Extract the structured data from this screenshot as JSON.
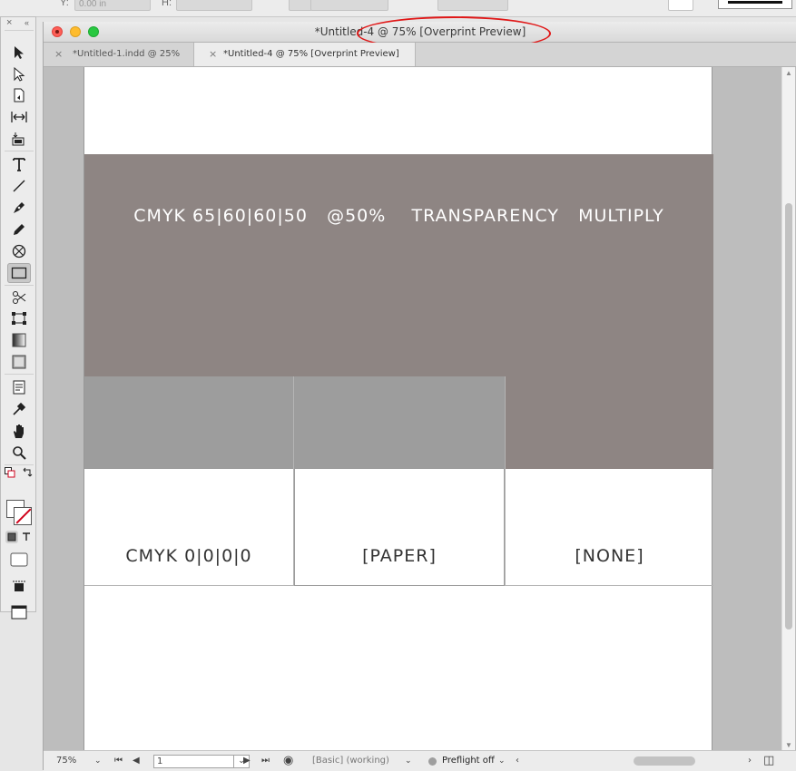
{
  "window": {
    "title": "*Untitled-4 @ 75% [Overprint Preview]"
  },
  "tabs": [
    {
      "label": "*Untitled-1.indd @ 25%",
      "close": "×"
    },
    {
      "label": "*Untitled-4 @ 75% [Overprint Preview]",
      "close": "×"
    }
  ],
  "control_bar": {
    "field_value": "0.00 in",
    "label_y": "Y:",
    "label_h": "H:"
  },
  "tools_panel": {
    "close": "×",
    "collapse": "«"
  },
  "canvas": {
    "top_frame_text": "CMYK 65|60|60|50   @50%    TRANSPARENCY   MULTIPLY",
    "top_frame_color": "#8e8583",
    "swatches": [
      {
        "label": "CMYK 0|0|0|0",
        "color": "#9d9d9d"
      },
      {
        "label": "[PAPER]",
        "color": "#9d9d9d"
      },
      {
        "label": "[NONE]",
        "color": "#8e8583"
      }
    ]
  },
  "status_bar": {
    "zoom": "75%",
    "page": "1",
    "profile": "[Basic] (working)",
    "preflight": "Preflight off"
  },
  "annotation": {
    "color": "#e01818"
  }
}
